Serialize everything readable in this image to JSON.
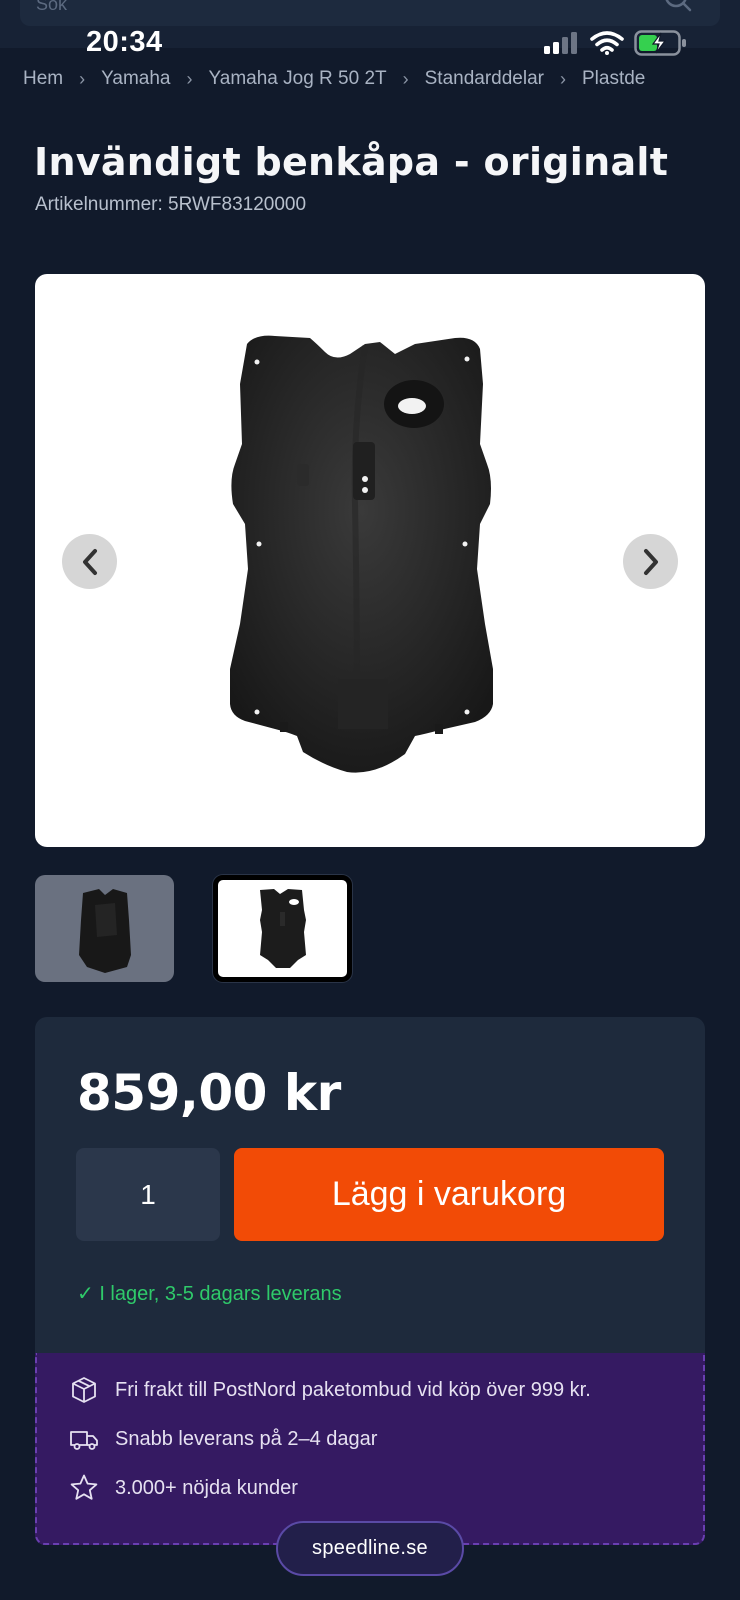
{
  "search": {
    "placeholder": "Sök"
  },
  "status_bar": {
    "time": "20:34"
  },
  "breadcrumb": [
    "Hem",
    "Yamaha",
    "Yamaha Jog R 50 2T",
    "Standarddelar",
    "Plastde"
  ],
  "product": {
    "title": "Invändigt benkåpa - originalt",
    "sku_label": "Artikelnummer: 5RWF83120000"
  },
  "purchase": {
    "price": "859,00 kr",
    "quantity": "1",
    "add_to_cart_label": "Lägg i varukorg",
    "stock_text": "✓ I lager, 3-5 dagars leverans"
  },
  "benefits": [
    {
      "icon": "box-icon",
      "text": "Fri frakt till PostNord paketombud vid köp över 999 kr."
    },
    {
      "icon": "truck-icon",
      "text": "Snabb leverans på 2–4 dagar"
    },
    {
      "icon": "star-icon",
      "text": "3.000+ nöjda kunder"
    }
  ],
  "site": {
    "domain": "speedline.se"
  },
  "colors": {
    "background": "#111a2b",
    "card": "#1e2a3c",
    "accent": "#f24b06",
    "stock_green": "#2fca6a",
    "benefits_bg": "#351a62"
  }
}
